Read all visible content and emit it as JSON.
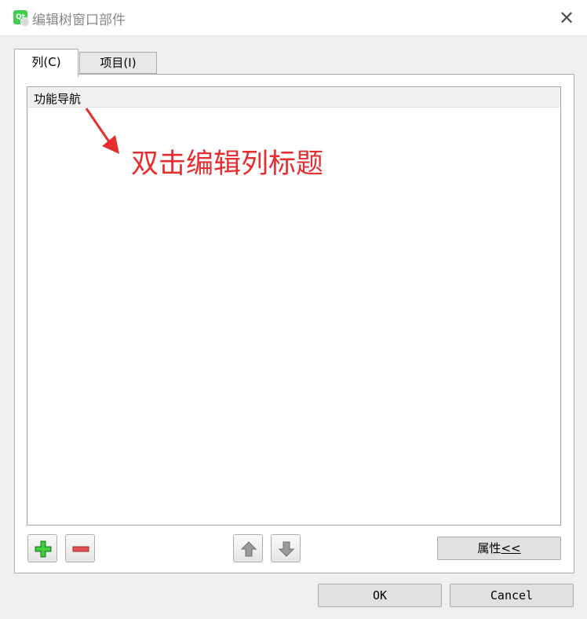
{
  "window": {
    "title": "编辑树窗口部件",
    "app_icon": "qt-icon",
    "close_glyph": "✕"
  },
  "tabs": [
    {
      "label": "列(C)",
      "active": true
    },
    {
      "label": "项目(I)",
      "active": false
    }
  ],
  "tree": {
    "columns": [
      "功能导航"
    ]
  },
  "annotation": {
    "text": "双击编辑列标题",
    "color": "#e62e2e"
  },
  "toolbar": {
    "icons": [
      "add-icon",
      "remove-icon",
      "move-up-icon",
      "move-down-icon"
    ],
    "properties": {
      "label": "属性",
      "mnemonic": "<<"
    }
  },
  "footer": {
    "ok_label": "OK",
    "cancel_label": "Cancel"
  },
  "colors": {
    "add_green": "#2fb52f",
    "remove_red": "#e05050",
    "arrow_gray": "#8a8a8a"
  }
}
